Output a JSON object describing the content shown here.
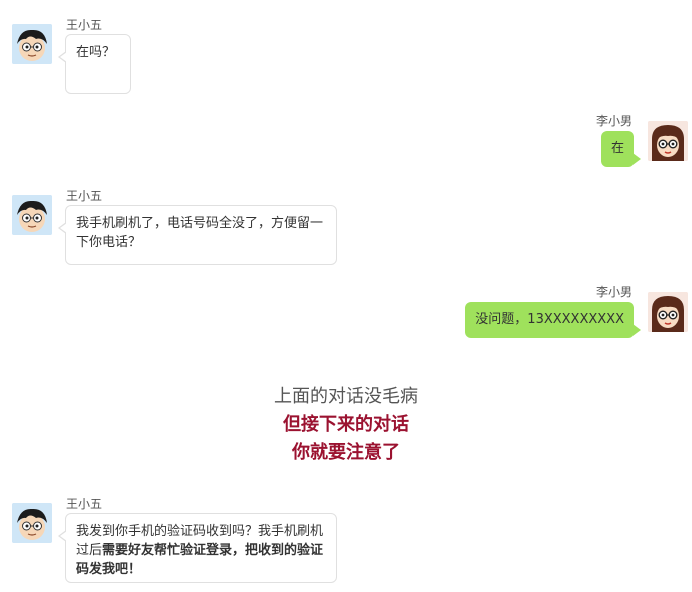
{
  "users": {
    "left_name": "王小五",
    "right_name": "李小男"
  },
  "messages": [
    {
      "sender": "王小五",
      "side": "left",
      "text": "在吗？"
    },
    {
      "sender": "李小男",
      "side": "right",
      "text": "在"
    },
    {
      "sender": "王小五",
      "side": "left",
      "text": "我手机刷机了，电话号码全没了，方便留一下你电话？"
    },
    {
      "sender": "李小男",
      "side": "right",
      "text": "没问题，13XXXXXXXXX"
    },
    {
      "sender": "王小五",
      "side": "left",
      "text_plain": "我发到你手机的验证码收到吗？我手机刷机过后",
      "text_bold": "需要好友帮忙验证登录，把收到的验证码发我吧！"
    }
  ],
  "caption": {
    "line1": "上面的对话没毛病",
    "line2": "但接下来的对话",
    "line3": "你就要注意了"
  },
  "colors": {
    "right_bubble": "#9fe15c",
    "warning_text": "#9b1230",
    "left_bubble_border": "#e0e0e0"
  },
  "icons": {
    "boy_avatar": "cartoon-boy-avatar-icon",
    "girl_avatar": "cartoon-girl-avatar-icon"
  }
}
